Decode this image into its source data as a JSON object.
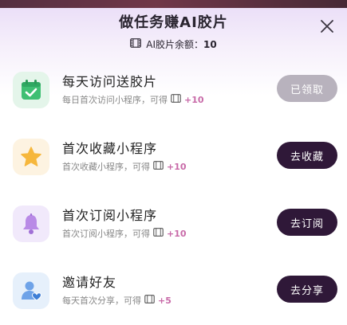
{
  "header": {
    "title": "做任务赚AI胶片",
    "balance_label": "AI胶片余额：",
    "balance_value": "10"
  },
  "tasks": [
    {
      "title": "每天访问送胶片",
      "subtitle": "每日首次访问小程序，可得",
      "reward": "+10",
      "button": "已领取",
      "icon": "calendar-check-icon"
    },
    {
      "title": "首次收藏小程序",
      "subtitle": "首次收藏小程序，可得",
      "reward": "+10",
      "button": "去收藏",
      "icon": "star-icon"
    },
    {
      "title": "首次订阅小程序",
      "subtitle": "首次订阅小程序，可得",
      "reward": "+10",
      "button": "去订阅",
      "icon": "bell-icon"
    },
    {
      "title": "邀请好友",
      "subtitle": "每天首次分享，可得",
      "reward": "+5",
      "button": "去分享",
      "icon": "user-heart-icon"
    }
  ],
  "colors": {
    "primary_button": "#2f1838",
    "disabled_button": "#b8b2bd",
    "reward": "#c86aa8"
  }
}
